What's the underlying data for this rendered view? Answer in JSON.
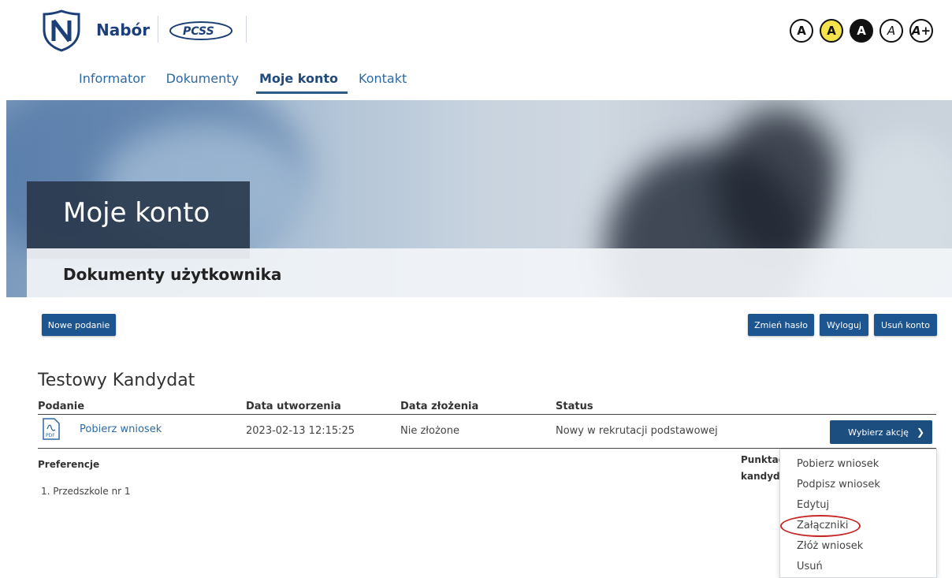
{
  "header": {
    "brand": "Nabór",
    "partner_logo_text": "PCSS",
    "accessibility": [
      "A",
      "A",
      "A",
      "A",
      "A+"
    ]
  },
  "nav": {
    "items": [
      {
        "label": "Informator"
      },
      {
        "label": "Dokumenty"
      },
      {
        "label": "Moje konto",
        "active": true
      },
      {
        "label": "Kontakt"
      }
    ]
  },
  "hero": {
    "title": "Moje konto",
    "subtitle": "Dokumenty użytkownika"
  },
  "buttons": {
    "new_application": "Nowe podanie",
    "change_password": "Zmień hasło",
    "logout": "Wyloguj",
    "delete_account": "Usuń konto"
  },
  "candidate": {
    "name": "Testowy Kandydat"
  },
  "table": {
    "headers": [
      "Podanie",
      "Data utworzenia",
      "Data złożenia",
      "Status"
    ],
    "row": {
      "document": "Pobierz wniosek",
      "created": "2023-02-13 12:15:25",
      "submitted": "Nie złożone",
      "status": "Nowy w rekrutacji podstawowej",
      "action_label": "Wybierz akcję"
    },
    "preferences_header": "Preferencje",
    "points_header": [
      "Punktac",
      "kandyda"
    ],
    "preferences": [
      "1. Przedszkole nr 1"
    ]
  },
  "dropdown": {
    "items": [
      "Pobierz wniosek",
      "Podpisz wniosek",
      "Edytuj",
      "Załączniki",
      "Złóż wniosek",
      "Usuń"
    ],
    "highlighted": "Załączniki"
  },
  "colors": {
    "primary_button": "#1d5590",
    "nav_link": "#2d6aa3",
    "brand": "#1d3f78",
    "highlight_ring": "#c62828"
  }
}
